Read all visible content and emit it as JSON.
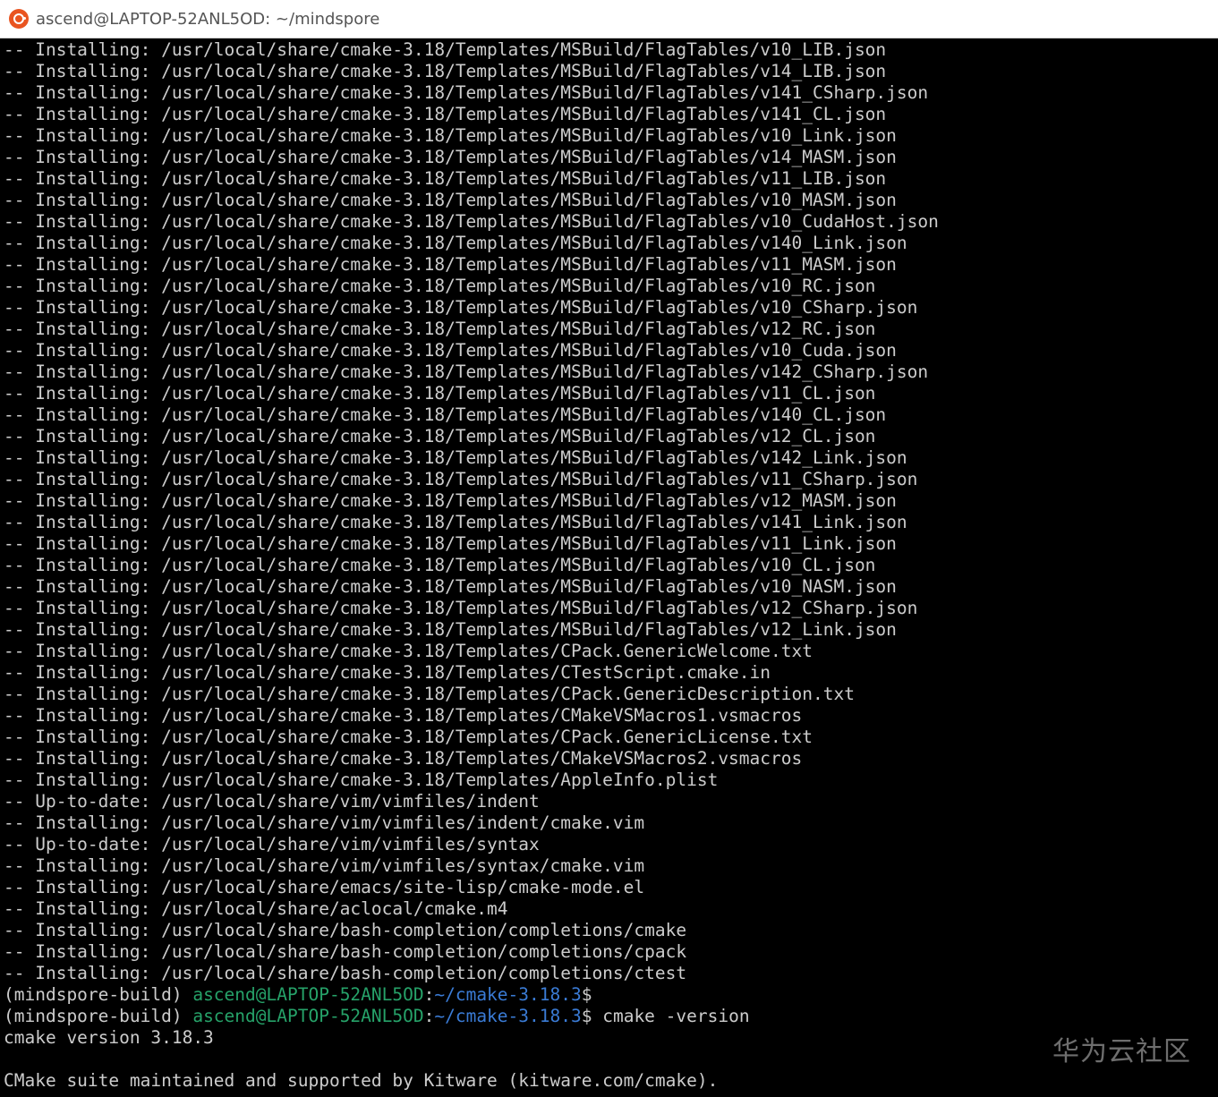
{
  "window": {
    "title": "ascend@LAPTOP-52ANL5OD: ~/mindspore",
    "icon": "ubuntu-terminal-icon"
  },
  "colors": {
    "background": "#000000",
    "text": "#cccccc",
    "host": "#26a269",
    "path": "#3a7bd5"
  },
  "terminal": {
    "output_lines": [
      "-- Installing: /usr/local/share/cmake-3.18/Templates/MSBuild/FlagTables/v10_LIB.json",
      "-- Installing: /usr/local/share/cmake-3.18/Templates/MSBuild/FlagTables/v14_LIB.json",
      "-- Installing: /usr/local/share/cmake-3.18/Templates/MSBuild/FlagTables/v141_CSharp.json",
      "-- Installing: /usr/local/share/cmake-3.18/Templates/MSBuild/FlagTables/v141_CL.json",
      "-- Installing: /usr/local/share/cmake-3.18/Templates/MSBuild/FlagTables/v10_Link.json",
      "-- Installing: /usr/local/share/cmake-3.18/Templates/MSBuild/FlagTables/v14_MASM.json",
      "-- Installing: /usr/local/share/cmake-3.18/Templates/MSBuild/FlagTables/v11_LIB.json",
      "-- Installing: /usr/local/share/cmake-3.18/Templates/MSBuild/FlagTables/v10_MASM.json",
      "-- Installing: /usr/local/share/cmake-3.18/Templates/MSBuild/FlagTables/v10_CudaHost.json",
      "-- Installing: /usr/local/share/cmake-3.18/Templates/MSBuild/FlagTables/v140_Link.json",
      "-- Installing: /usr/local/share/cmake-3.18/Templates/MSBuild/FlagTables/v11_MASM.json",
      "-- Installing: /usr/local/share/cmake-3.18/Templates/MSBuild/FlagTables/v10_RC.json",
      "-- Installing: /usr/local/share/cmake-3.18/Templates/MSBuild/FlagTables/v10_CSharp.json",
      "-- Installing: /usr/local/share/cmake-3.18/Templates/MSBuild/FlagTables/v12_RC.json",
      "-- Installing: /usr/local/share/cmake-3.18/Templates/MSBuild/FlagTables/v10_Cuda.json",
      "-- Installing: /usr/local/share/cmake-3.18/Templates/MSBuild/FlagTables/v142_CSharp.json",
      "-- Installing: /usr/local/share/cmake-3.18/Templates/MSBuild/FlagTables/v11_CL.json",
      "-- Installing: /usr/local/share/cmake-3.18/Templates/MSBuild/FlagTables/v140_CL.json",
      "-- Installing: /usr/local/share/cmake-3.18/Templates/MSBuild/FlagTables/v12_CL.json",
      "-- Installing: /usr/local/share/cmake-3.18/Templates/MSBuild/FlagTables/v142_Link.json",
      "-- Installing: /usr/local/share/cmake-3.18/Templates/MSBuild/FlagTables/v11_CSharp.json",
      "-- Installing: /usr/local/share/cmake-3.18/Templates/MSBuild/FlagTables/v12_MASM.json",
      "-- Installing: /usr/local/share/cmake-3.18/Templates/MSBuild/FlagTables/v141_Link.json",
      "-- Installing: /usr/local/share/cmake-3.18/Templates/MSBuild/FlagTables/v11_Link.json",
      "-- Installing: /usr/local/share/cmake-3.18/Templates/MSBuild/FlagTables/v10_CL.json",
      "-- Installing: /usr/local/share/cmake-3.18/Templates/MSBuild/FlagTables/v10_NASM.json",
      "-- Installing: /usr/local/share/cmake-3.18/Templates/MSBuild/FlagTables/v12_CSharp.json",
      "-- Installing: /usr/local/share/cmake-3.18/Templates/MSBuild/FlagTables/v12_Link.json",
      "-- Installing: /usr/local/share/cmake-3.18/Templates/CPack.GenericWelcome.txt",
      "-- Installing: /usr/local/share/cmake-3.18/Templates/CTestScript.cmake.in",
      "-- Installing: /usr/local/share/cmake-3.18/Templates/CPack.GenericDescription.txt",
      "-- Installing: /usr/local/share/cmake-3.18/Templates/CMakeVSMacros1.vsmacros",
      "-- Installing: /usr/local/share/cmake-3.18/Templates/CPack.GenericLicense.txt",
      "-- Installing: /usr/local/share/cmake-3.18/Templates/CMakeVSMacros2.vsmacros",
      "-- Installing: /usr/local/share/cmake-3.18/Templates/AppleInfo.plist",
      "-- Up-to-date: /usr/local/share/vim/vimfiles/indent",
      "-- Installing: /usr/local/share/vim/vimfiles/indent/cmake.vim",
      "-- Up-to-date: /usr/local/share/vim/vimfiles/syntax",
      "-- Installing: /usr/local/share/vim/vimfiles/syntax/cmake.vim",
      "-- Installing: /usr/local/share/emacs/site-lisp/cmake-mode.el",
      "-- Installing: /usr/local/share/aclocal/cmake.m4",
      "-- Installing: /usr/local/share/bash-completion/completions/cmake",
      "-- Installing: /usr/local/share/bash-completion/completions/cpack",
      "-- Installing: /usr/local/share/bash-completion/completions/ctest"
    ],
    "prompt1": {
      "env": "(mindspore-build) ",
      "host": "ascend@LAPTOP-52ANL5OD",
      "colon": ":",
      "path": "~/cmake-3.18.3",
      "symbol": "$",
      "command": ""
    },
    "prompt2": {
      "env": "(mindspore-build) ",
      "host": "ascend@LAPTOP-52ANL5OD",
      "colon": ":",
      "path": "~/cmake-3.18.3",
      "symbol": "$",
      "command": " cmake -version"
    },
    "version_line": "cmake version 3.18.3",
    "blank_line": "",
    "suite_line": "CMake suite maintained and supported by Kitware (kitware.com/cmake)."
  },
  "watermark": "华为云社区"
}
